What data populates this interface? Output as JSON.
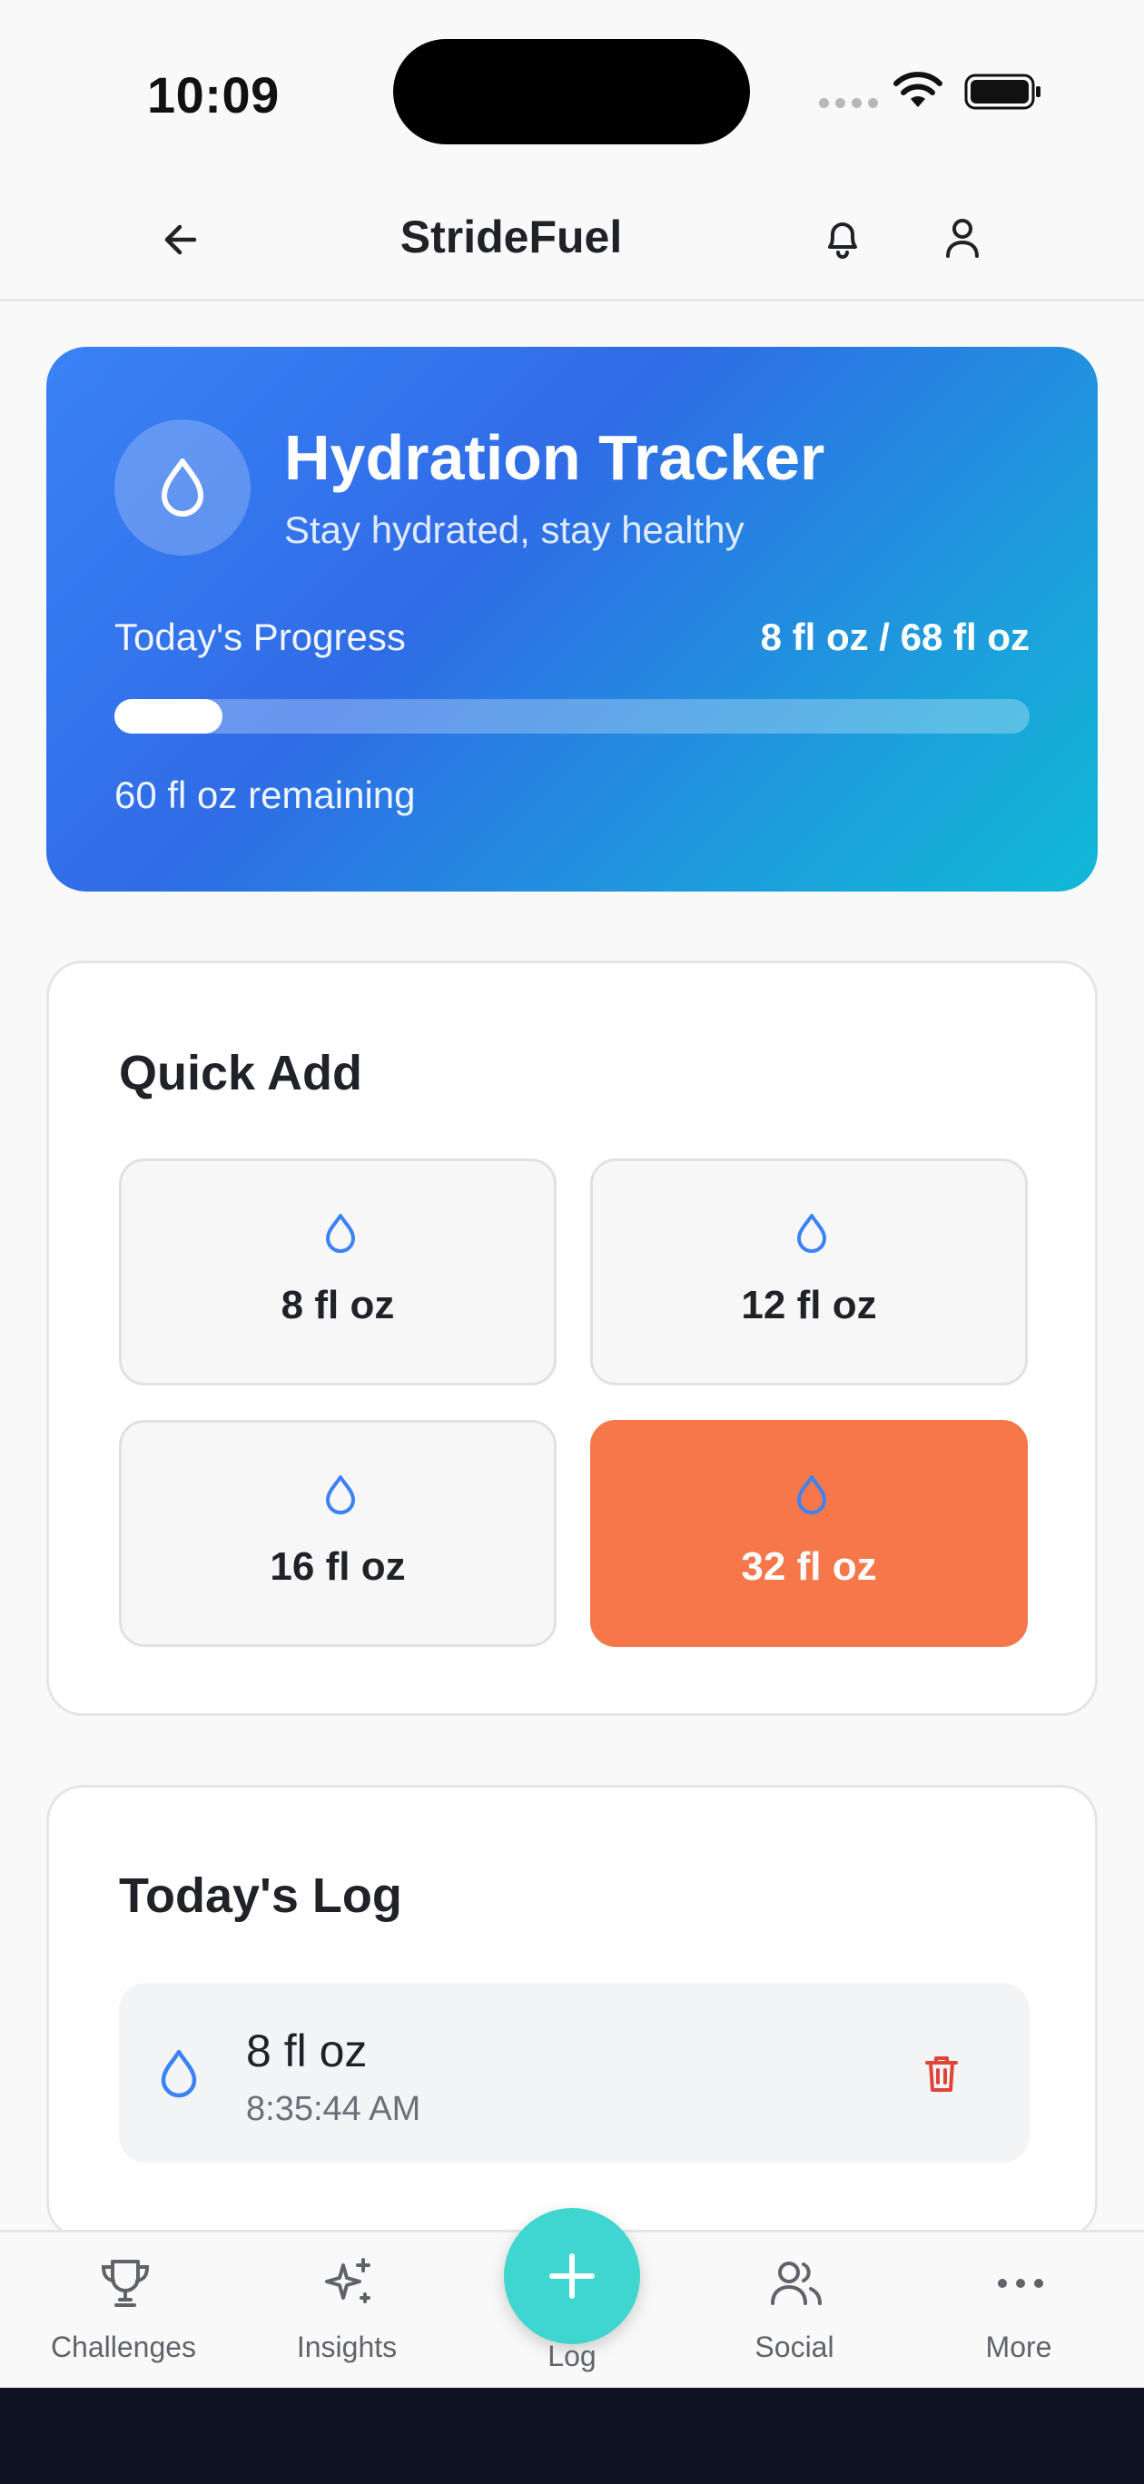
{
  "status_bar": {
    "time": "10:09"
  },
  "header": {
    "title": "StrideFuel",
    "back_icon": "arrow-left-icon",
    "notification_icon": "bell-icon",
    "profile_icon": "user-icon"
  },
  "hero": {
    "title": "Hydration Tracker",
    "subtitle": "Stay hydrated, stay healthy",
    "progress_label": "Today's Progress",
    "progress_text": "8 fl oz / 68 fl oz",
    "progress_fraction": 0.118,
    "remaining": "60 fl oz remaining",
    "colors": {
      "gradient_start": "#3b82f6",
      "gradient_end": "#10b9d6"
    }
  },
  "quick_add": {
    "title": "Quick Add",
    "options": [
      {
        "label": "8 fl oz",
        "selected": false
      },
      {
        "label": "12 fl oz",
        "selected": false
      },
      {
        "label": "16 fl oz",
        "selected": false
      },
      {
        "label": "32 fl oz",
        "selected": true
      }
    ],
    "colors": {
      "selected": "#f5774a",
      "drop": "#3b82f6"
    }
  },
  "log": {
    "title": "Today's Log",
    "entries": [
      {
        "amount": "8 fl oz",
        "time": "8:35:44 AM"
      }
    ],
    "colors": {
      "delete": "#e0433a"
    }
  },
  "bottom_nav": {
    "items": [
      {
        "label": "Challenges",
        "icon": "trophy-icon"
      },
      {
        "label": "Insights",
        "icon": "sparkles-icon"
      },
      {
        "label": "Log",
        "icon": "plus-icon"
      },
      {
        "label": "Social",
        "icon": "users-icon"
      },
      {
        "label": "More",
        "icon": "ellipsis-icon"
      }
    ],
    "colors": {
      "fab": "#3fd6cf"
    }
  }
}
